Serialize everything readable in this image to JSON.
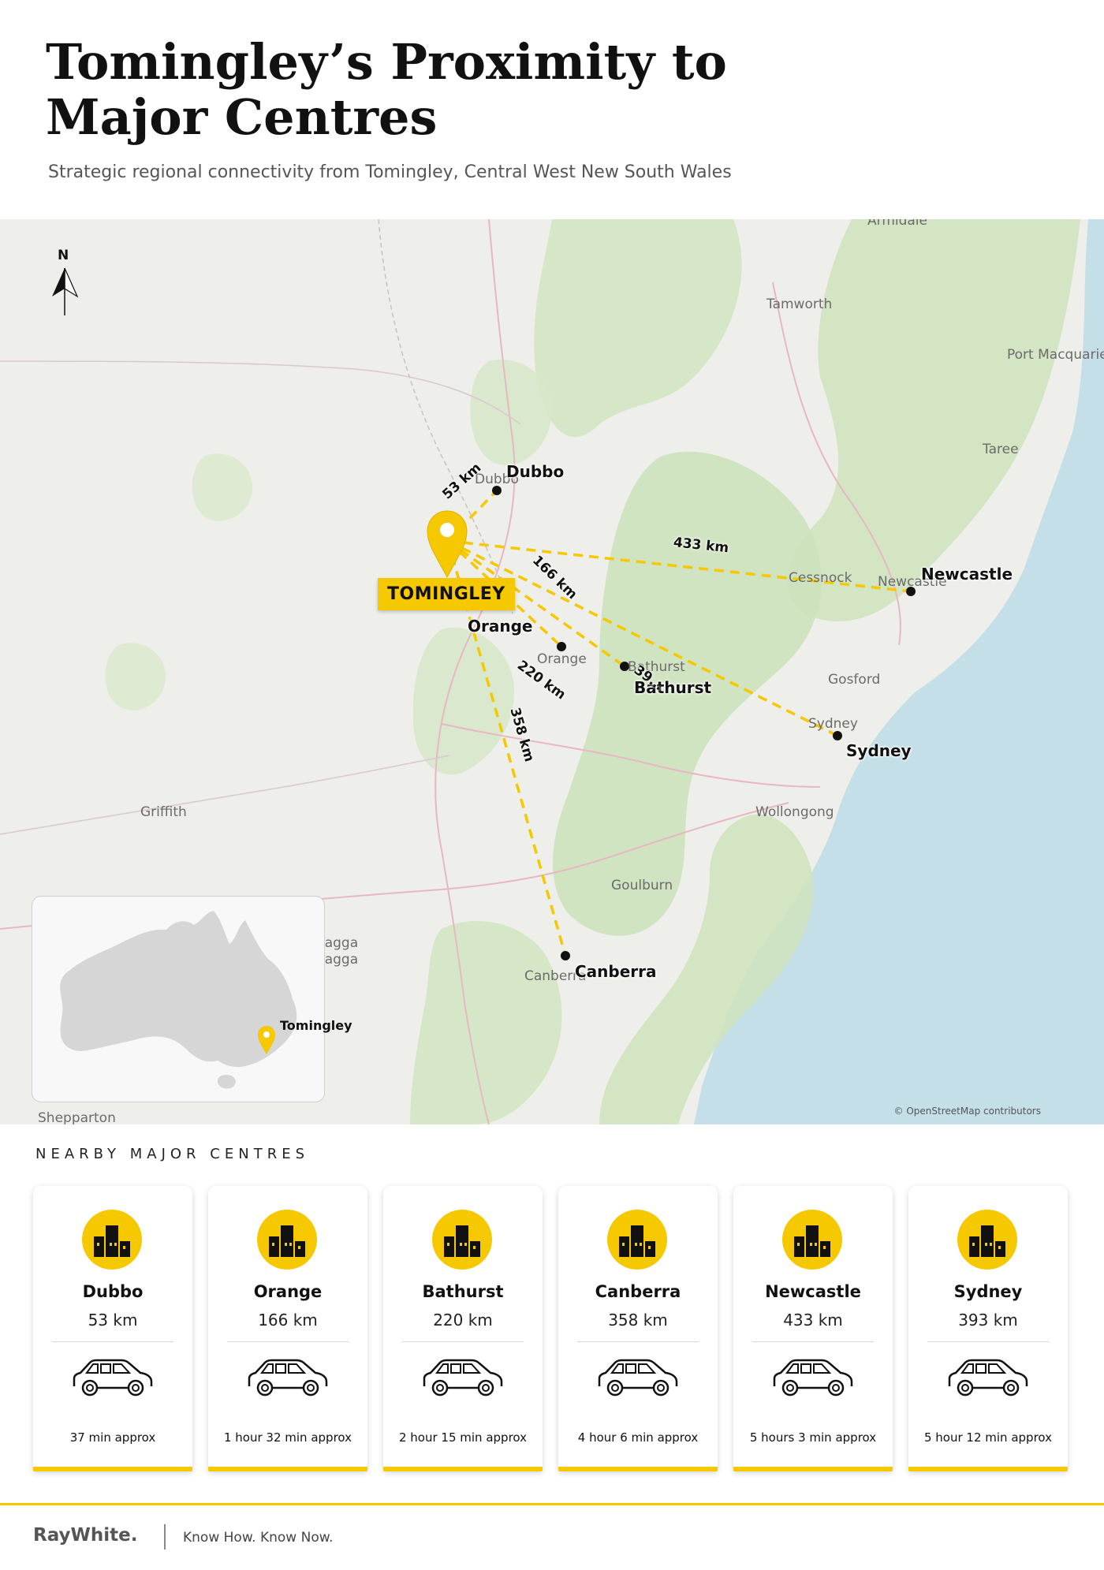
{
  "header": {
    "title_line1": "Tomingley’s Proximity to",
    "title_line2": "Major Centres",
    "subtitle": "Strategic regional connectivity from Tomingley, Central West New South Wales"
  },
  "map": {
    "north_label": "N",
    "origin_label": "TOMINGLEY",
    "base_places": [
      "Armidale",
      "Tamworth",
      "Port Macquarie",
      "Taree",
      "Dubbo",
      "Cessnock",
      "Newcastle",
      "Gosford",
      "Orange",
      "Bathurst",
      "Sydney",
      "Wollongong",
      "Goulburn",
      "Griffith",
      "Wagga Wagga",
      "Canberra",
      "Shepparton"
    ],
    "destinations": [
      {
        "name": "Dubbo",
        "distance_label": "53 km"
      },
      {
        "name": "Newcastle",
        "distance_label": "433 km"
      },
      {
        "name": "Orange",
        "distance_label": "166 km"
      },
      {
        "name": "Bathurst",
        "distance_label": "39…"
      },
      {
        "name": "Sydney",
        "distance_label": "220 km"
      },
      {
        "name": "Canberra",
        "distance_label": "358 km"
      }
    ],
    "inset_label": "Tomingley",
    "attribution": "© OpenStreetMap contributors",
    "colors": {
      "accent": "#f5c800",
      "land": "#eeeeea",
      "forest": "#cfe3bf",
      "water": "#c4dfe7"
    }
  },
  "nearby": {
    "section_title": "NEARBY MAJOR CENTRES",
    "cards": [
      {
        "city": "Dubbo",
        "distance": "53 km",
        "drive_time": "37 min approx",
        "icon": "city-buildings-icon",
        "car_icon": "car-icon"
      },
      {
        "city": "Orange",
        "distance": "166 km",
        "drive_time": "1 hour 32 min approx",
        "icon": "city-buildings-icon",
        "car_icon": "car-icon"
      },
      {
        "city": "Bathurst",
        "distance": "220 km",
        "drive_time": "2 hour 15 min approx",
        "icon": "city-buildings-icon",
        "car_icon": "car-icon"
      },
      {
        "city": "Canberra",
        "distance": "358 km",
        "drive_time": "4 hour 6 min approx",
        "icon": "city-buildings-icon",
        "car_icon": "car-icon"
      },
      {
        "city": "Newcastle",
        "distance": "433 km",
        "drive_time": "5 hours 3 min approx",
        "icon": "city-buildings-icon",
        "car_icon": "car-icon"
      },
      {
        "city": "Sydney",
        "distance": "393 km",
        "drive_time": "5 hour 12 min approx",
        "icon": "city-buildings-icon",
        "car_icon": "car-icon"
      }
    ]
  },
  "footer": {
    "brand": "RayWhite.",
    "tagline": "Know How. Know Now."
  }
}
